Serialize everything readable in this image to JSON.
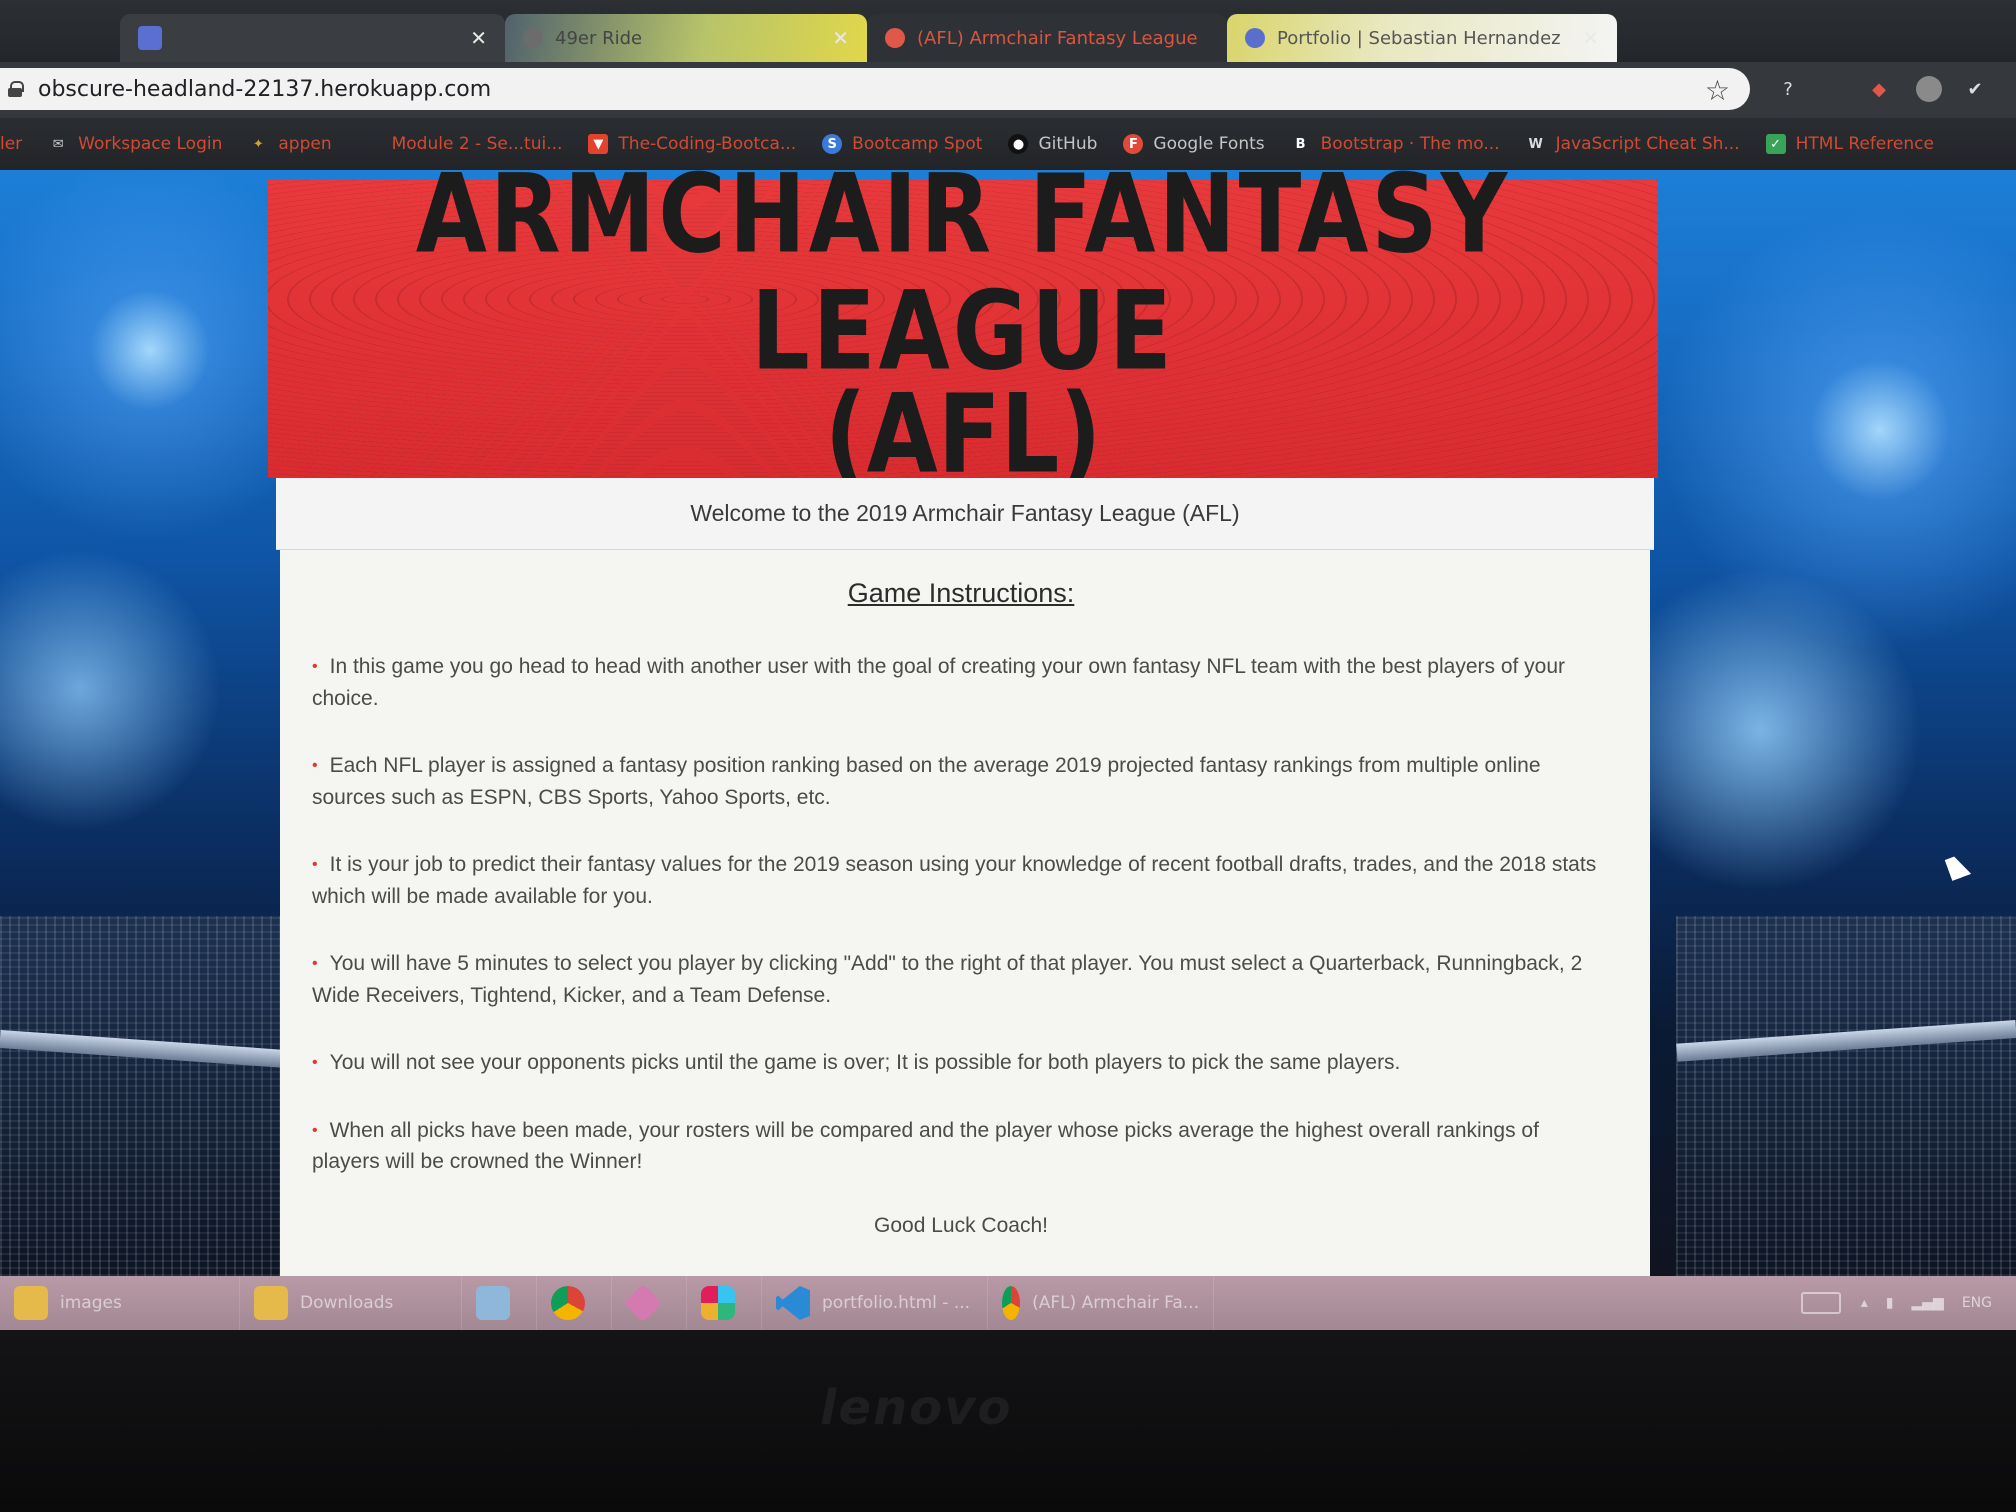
{
  "browser": {
    "tabs": [
      {
        "title": "",
        "icon": "app-icon"
      },
      {
        "title": "49er Ride",
        "icon": "web-icon"
      },
      {
        "title": "(AFL) Armchair Fantasy League",
        "icon": "afl-favicon"
      },
      {
        "title": "Portfolio | Sebastian Hernandez",
        "icon": "portfolio-favicon"
      }
    ],
    "close_glyph": "✕",
    "url": "obscure-headland-22137.herokuapp.com",
    "bookmarks": [
      {
        "label": "ler",
        "icon": ""
      },
      {
        "label": "Workspace Login",
        "icon": "envelope-icon"
      },
      {
        "label": "appen",
        "icon": "appen-icon"
      },
      {
        "label": "Module 2 - Se...tui...",
        "icon": ""
      },
      {
        "label": "The-Coding-Bootca...",
        "icon": "gitlab-icon"
      },
      {
        "label": "Bootcamp Spot",
        "icon": "bootcamp-icon"
      },
      {
        "label": "GitHub",
        "icon": "github-icon"
      },
      {
        "label": "Google Fonts",
        "icon": "google-fonts-icon"
      },
      {
        "label": "Bootstrap · The mo...",
        "icon": "bootstrap-icon"
      },
      {
        "label": "JavaScript Cheat Sh...",
        "icon": "w3-icon"
      },
      {
        "label": "HTML Reference",
        "icon": "html-reference-icon"
      }
    ]
  },
  "page": {
    "hero_title": "ARMCHAIR FANTASY LEAGUE",
    "hero_subtitle": "(AFL)",
    "welcome": "Welcome to the 2019 Armchair Fantasy League (AFL)",
    "instructions_heading": "Game Instructions:",
    "bullet": "•",
    "instructions": [
      "In this game you go head to head with another user with the goal of creating your own fantasy NFL team with the best players of your choice.",
      "Each NFL player is assigned a fantasy position ranking based on the average 2019 projected fantasy rankings from multiple online sources such as ESPN, CBS Sports, Yahoo Sports, etc.",
      "It is your job to predict their fantasy values for the 2019 season using your knowledge of recent football drafts, trades, and the 2018 stats which will be made available for you.",
      "You will have 5 minutes to select you player by clicking \"Add\" to the right of that player. You must select a Quarterback, Runningback, 2 Wide Receivers, Tightend, Kicker, and a Team Defense.",
      "You will not see your opponents picks until the game is over; It is possible for both players to pick the same players.",
      "When all picks have been made, your rosters will be compared and the player whose picks average the highest overall rankings of players will be crowned the Winner!"
    ],
    "closing": "Good Luck Coach!"
  },
  "taskbar": {
    "items": [
      {
        "label": "images",
        "icon": "folder-icon"
      },
      {
        "label": "Downloads",
        "icon": "folder-icon"
      },
      {
        "label": "",
        "icon": "notes-icon"
      },
      {
        "label": "",
        "icon": "chrome-icon"
      },
      {
        "label": "",
        "icon": "pin-icon"
      },
      {
        "label": "",
        "icon": "slack-icon"
      },
      {
        "label": "portfolio.html - ...",
        "icon": "vscode-icon"
      },
      {
        "label": "(AFL) Armchair Fa...",
        "icon": "chrome-icon"
      }
    ],
    "tray_lang": "ENG"
  },
  "bezel_brand": "lenovo",
  "colors": {
    "hero_red": "#e0363a",
    "accent_red": "#e03a2c",
    "bookmark_text": "#d14a32"
  }
}
